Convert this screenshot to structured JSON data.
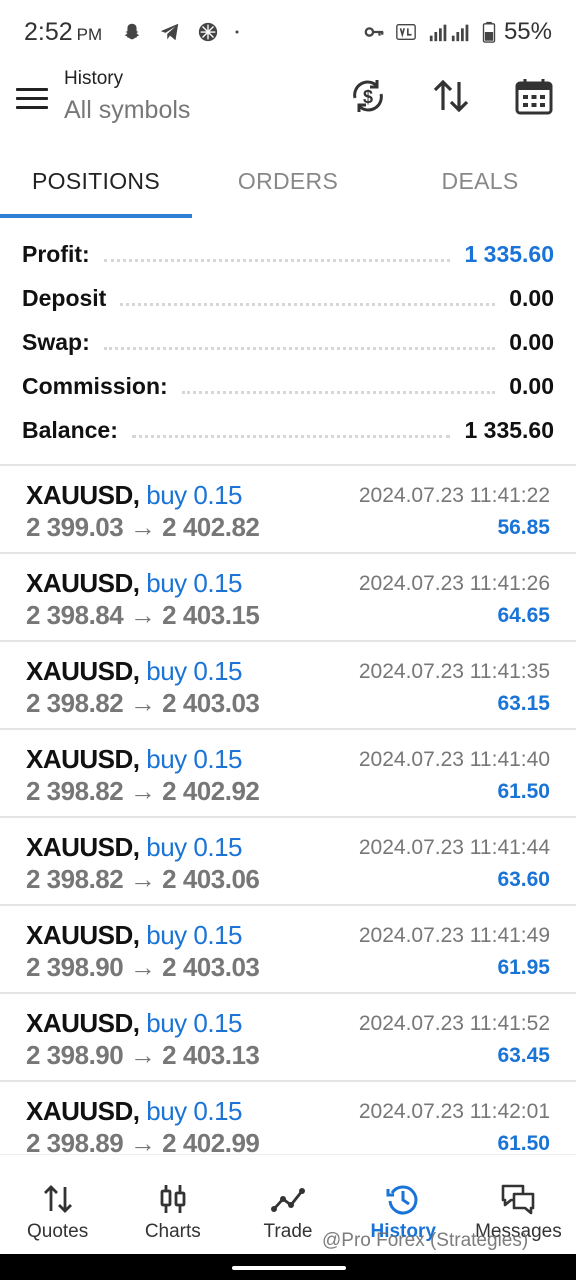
{
  "status_bar": {
    "time": "2:52",
    "ampm": "PM",
    "battery": "55%",
    "icons": [
      "snapchat-icon",
      "telegram-icon",
      "app-icon",
      "dot-icon",
      "key-icon",
      "volte-icon",
      "signal-icon",
      "battery-icon"
    ]
  },
  "app_bar": {
    "title": "History",
    "subtitle": "All symbols",
    "icons": [
      "menu-icon",
      "currency-refresh-icon",
      "sort-icon",
      "calendar-icon"
    ]
  },
  "tabs": [
    {
      "label": "POSITIONS",
      "active": true
    },
    {
      "label": "ORDERS",
      "active": false
    },
    {
      "label": "DEALS",
      "active": false
    }
  ],
  "summary": {
    "profit_label": "Profit:",
    "profit_value": "1 335.60",
    "deposit_label": "Deposit",
    "deposit_value": "0.00",
    "swap_label": "Swap:",
    "swap_value": "0.00",
    "commission_label": "Commission:",
    "commission_value": "0.00",
    "balance_label": "Balance:",
    "balance_value": "1 335.60"
  },
  "deals": [
    {
      "symbol": "XAUUSD,",
      "type": "buy 0.15",
      "prices": "2 399.03 → 2 402.82",
      "time": "2024.07.23 11:41:22",
      "profit": "56.85"
    },
    {
      "symbol": "XAUUSD,",
      "type": "buy 0.15",
      "prices": "2 398.84 → 2 403.15",
      "time": "2024.07.23 11:41:26",
      "profit": "64.65"
    },
    {
      "symbol": "XAUUSD,",
      "type": "buy 0.15",
      "prices": "2 398.82 → 2 403.03",
      "time": "2024.07.23 11:41:35",
      "profit": "63.15"
    },
    {
      "symbol": "XAUUSD,",
      "type": "buy 0.15",
      "prices": "2 398.82 → 2 402.92",
      "time": "2024.07.23 11:41:40",
      "profit": "61.50"
    },
    {
      "symbol": "XAUUSD,",
      "type": "buy 0.15",
      "prices": "2 398.82 → 2 403.06",
      "time": "2024.07.23 11:41:44",
      "profit": "63.60"
    },
    {
      "symbol": "XAUUSD,",
      "type": "buy 0.15",
      "prices": "2 398.90 → 2 403.03",
      "time": "2024.07.23 11:41:49",
      "profit": "61.95"
    },
    {
      "symbol": "XAUUSD,",
      "type": "buy 0.15",
      "prices": "2 398.90 → 2 403.13",
      "time": "2024.07.23 11:41:52",
      "profit": "63.45"
    },
    {
      "symbol": "XAUUSD,",
      "type": "buy 0.15",
      "prices": "2 398.89 → 2 402.99",
      "time": "2024.07.23 11:42:01",
      "profit": "61.50"
    }
  ],
  "bottom_nav": [
    {
      "label": "Quotes",
      "icon": "quotes-icon",
      "active": false
    },
    {
      "label": "Charts",
      "icon": "charts-icon",
      "active": false
    },
    {
      "label": "Trade",
      "icon": "trade-icon",
      "active": false
    },
    {
      "label": "History",
      "icon": "history-icon",
      "active": true
    },
    {
      "label": "Messages",
      "icon": "messages-icon",
      "active": false
    }
  ],
  "watermark": "@Pro Forex (Strategies)",
  "colors": {
    "accent": "#1a73d6",
    "tab_indicator": "#2f7fd6",
    "muted": "#777777"
  }
}
